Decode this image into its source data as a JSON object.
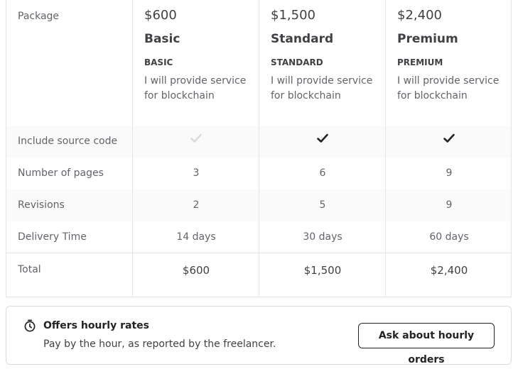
{
  "table": {
    "package_label": "Package",
    "packages": [
      {
        "price": "$600",
        "name": "Basic",
        "tier": "BASIC",
        "description": "I will provide service for blockchain"
      },
      {
        "price": "$1,500",
        "name": "Standard",
        "tier": "STANDARD",
        "description": "I will provide service for blockchain"
      },
      {
        "price": "$2,400",
        "name": "Premium",
        "tier": "PREMIUM",
        "description": "I will provide service for blockchain"
      }
    ],
    "rows": {
      "source_code": {
        "label": "Include source code",
        "values": [
          false,
          true,
          true
        ]
      },
      "pages": {
        "label": "Number of pages",
        "values": [
          "3",
          "6",
          "9"
        ]
      },
      "revisions": {
        "label": "Revisions",
        "values": [
          "2",
          "5",
          "9"
        ]
      },
      "delivery": {
        "label": "Delivery Time",
        "values": [
          "14 days",
          "30 days",
          "60 days"
        ]
      },
      "total": {
        "label": "Total",
        "values": [
          "$600",
          "$1,500",
          "$2,400"
        ]
      }
    },
    "colors": {
      "check_included": "#222325",
      "check_excluded": "#dadbdd"
    },
    "icons": {
      "included": "check-icon",
      "excluded": "check-icon-disabled"
    }
  },
  "hourly": {
    "icon": "clock-icon",
    "title": "Offers hourly rates",
    "subtitle": "Pay by the hour, as reported by the freelancer.",
    "button_label": "Ask about hourly orders"
  }
}
